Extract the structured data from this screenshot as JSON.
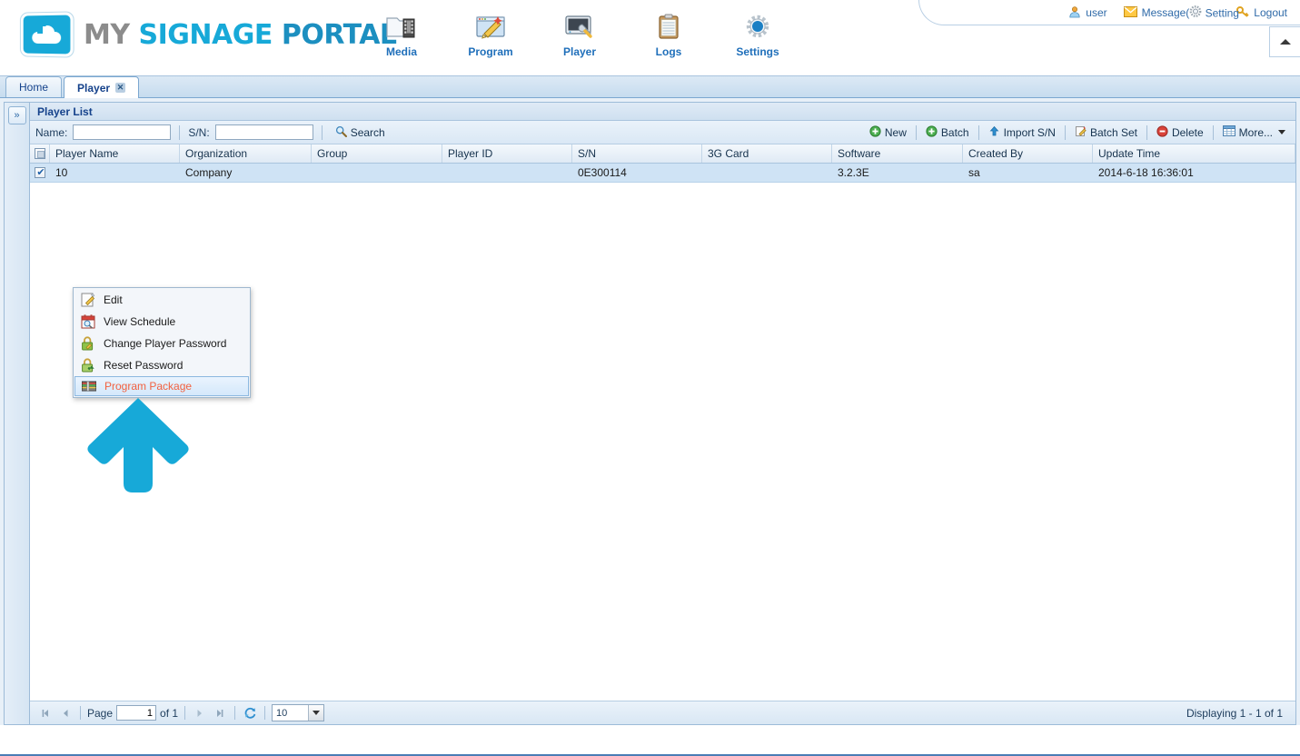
{
  "header": {
    "logo": {
      "my": "MY",
      "signage": "SIGNAGE",
      "portal": "PORTAL",
      "icon": "cloud-upload-icon"
    },
    "user_link": "user",
    "message_link": "Message(",
    "setting_link": "Setting",
    "logout_link": "Logout",
    "collapse_icon": "chevron-up-icon",
    "nav": [
      {
        "label": "Media",
        "icon": "media-folder-icon"
      },
      {
        "label": "Program",
        "icon": "program-window-icon"
      },
      {
        "label": "Player",
        "icon": "player-monitor-icon"
      },
      {
        "label": "Logs",
        "icon": "logs-clipboard-icon"
      },
      {
        "label": "Settings",
        "icon": "settings-gear-icon"
      }
    ]
  },
  "tabs": [
    {
      "label": "Home",
      "active": false,
      "closable": false
    },
    {
      "label": "Player",
      "active": true,
      "closable": true,
      "close_icon": "close-icon"
    }
  ],
  "sidebar": {
    "expand_label": "»",
    "expand_icon": "expand-right-icon"
  },
  "panel": {
    "title": "Player List",
    "search": {
      "name_label": "Name:",
      "name_value": "",
      "sn_label": "S/N:",
      "sn_value": "",
      "search_label": "Search",
      "search_icon": "magnifier-icon"
    },
    "toolbar_buttons": [
      {
        "label": "New",
        "icon": "plus-circle-green-icon"
      },
      {
        "label": "Batch",
        "icon": "plus-circle-green-icon"
      },
      {
        "label": "Import S/N",
        "icon": "upload-arrow-icon"
      },
      {
        "label": "Batch Set",
        "icon": "edit-pencil-icon"
      },
      {
        "label": "Delete",
        "icon": "delete-circle-red-icon"
      },
      {
        "label": "More...",
        "icon": "grid-table-icon",
        "has_caret": true
      }
    ],
    "grid": {
      "columns": [
        "Player Name",
        "Organization",
        "Group",
        "Player ID",
        "S/N",
        "3G Card",
        "Software",
        "Created By",
        "Update Time"
      ],
      "rows": [
        {
          "selected": true,
          "cells": [
            "10",
            "Company",
            "",
            "",
            "0E300114",
            "",
            "3.2.3E",
            "sa",
            "2014-6-18 16:36:01"
          ]
        }
      ]
    }
  },
  "context_menu": {
    "items": [
      {
        "label": "Edit",
        "icon": "edit-pencil-icon",
        "highlighted": false
      },
      {
        "label": "View Schedule",
        "icon": "calendar-search-icon",
        "highlighted": false
      },
      {
        "label": "Change Player Password",
        "icon": "lock-edit-icon",
        "highlighted": false
      },
      {
        "label": "Reset Password",
        "icon": "lock-reset-icon",
        "highlighted": false
      },
      {
        "label": "Program Package",
        "icon": "package-archive-icon",
        "highlighted": true
      }
    ],
    "highlight_color": "#f2613f"
  },
  "annotation": {
    "icon": "up-arrow-pointer",
    "color": "#17a9d8"
  },
  "pager": {
    "first_icon": "first-page-icon",
    "prev_icon": "prev-page-icon",
    "page_label": "Page",
    "page_value": "1",
    "of_label": "of 1",
    "next_icon": "next-page-icon",
    "last_icon": "last-page-icon",
    "refresh_icon": "refresh-icon",
    "page_size": "10",
    "page_size_caret": "chevron-down-icon",
    "status": "Displaying 1 - 1 of 1"
  }
}
